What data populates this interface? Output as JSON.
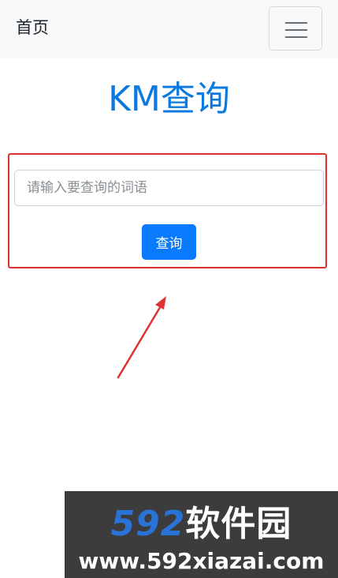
{
  "navbar": {
    "brand": "首页",
    "menu_icon": "hamburger-menu-icon"
  },
  "page": {
    "title": "KM查询"
  },
  "search": {
    "placeholder": "请输入要查询的词语",
    "value": "",
    "button_label": "查询"
  },
  "annotation": {
    "highlight_color": "#e0332f",
    "arrow_color": "#e0332f"
  },
  "watermark": {
    "brand_number": "592",
    "brand_text": "软件园",
    "url": "www.592xiazai.com"
  },
  "colors": {
    "title": "#0b79df",
    "button": "#0a7bff",
    "navbar_bg": "#f8f9fa"
  }
}
